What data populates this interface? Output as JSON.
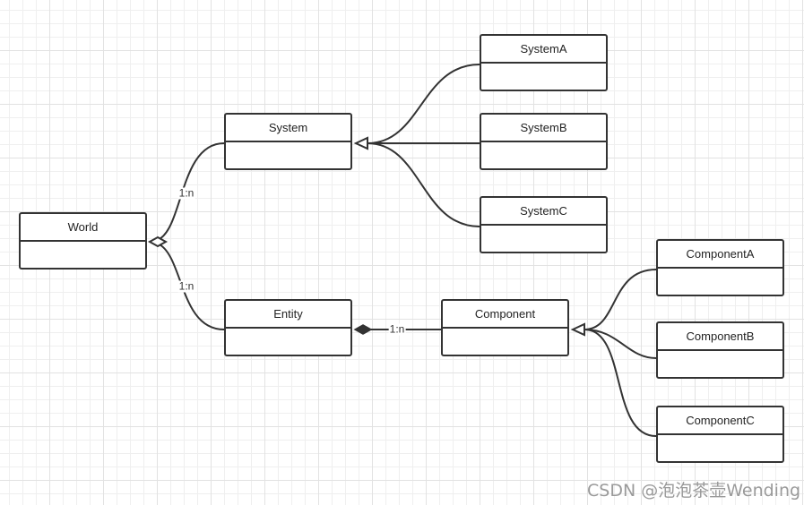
{
  "classes": {
    "world": "World",
    "system": "System",
    "system_a": "SystemA",
    "system_b": "SystemB",
    "system_c": "SystemC",
    "entity": "Entity",
    "component": "Component",
    "component_a": "ComponentA",
    "component_b": "ComponentB",
    "component_c": "ComponentC"
  },
  "relations": {
    "world_system": "1:n",
    "world_entity": "1:n",
    "entity_component": "1:n"
  },
  "watermark": "CSDN @泡泡茶壶Wending"
}
